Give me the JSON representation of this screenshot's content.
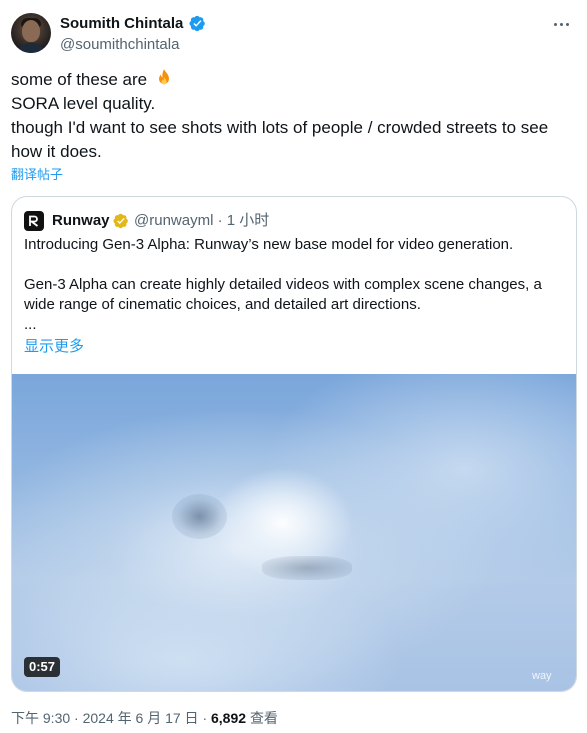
{
  "author": {
    "display_name": "Soumith Chintala",
    "handle": "@soumithchintala",
    "verified": true
  },
  "tweet": {
    "lines": [
      "some of these are",
      "SORA level quality.",
      "though I'd want to see shots with lots of people / crowded streets to see how it does."
    ],
    "emoji": "fire-icon",
    "translate_label": "翻译帖子"
  },
  "quote": {
    "display_name": "Runway",
    "handle": "@runwayml",
    "separator": "·",
    "time": "1 小时",
    "paragraph1": "Introducing Gen-3 Alpha: Runway’s new base model for video generation.",
    "paragraph2": "Gen-3 Alpha can create highly detailed videos with complex scene changes, a wide range of cinematic choices, and detailed art directions.",
    "ellipsis": "...",
    "show_more": "显示更多",
    "video": {
      "duration": "0:57",
      "watermark": "way"
    }
  },
  "footer": {
    "time": "下午 9:30",
    "separator": "·",
    "date": "2024 年 6 月 17 日",
    "views_count": "6,892",
    "views_label": "查看"
  },
  "colors": {
    "link": "#1d9bf0",
    "verified_blue": "#1d9bf0",
    "verified_gold": "#e2b719",
    "secondary_text": "#536471",
    "border": "#cfd9de"
  }
}
